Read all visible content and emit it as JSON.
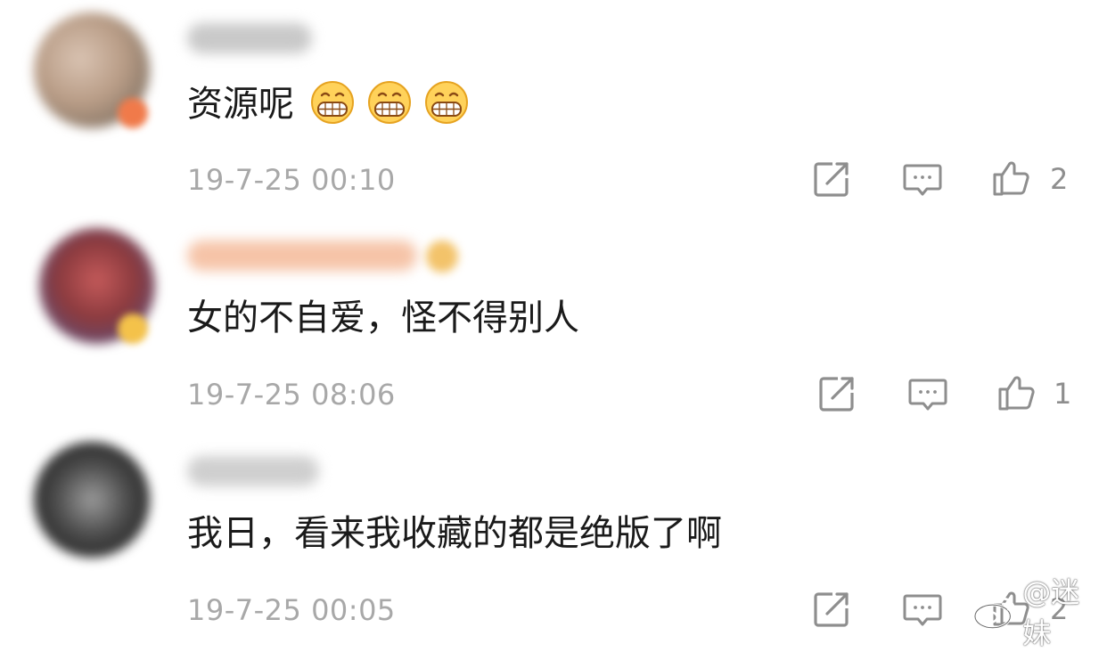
{
  "comments": [
    {
      "text": "资源呢",
      "emoji": [
        "grinning-face-icon",
        "grinning-face-icon",
        "grinning-face-icon"
      ],
      "time": "19-7-25 00:10",
      "likes": "2"
    },
    {
      "text": "女的不自爱，怪不得别人",
      "time": "19-7-25 08:06",
      "likes": "1"
    },
    {
      "text": "我日，看来我收藏的都是绝版了啊",
      "time": "19-7-25 00:05",
      "likes": "2"
    }
  ],
  "watermark": {
    "text": "@迷妹"
  },
  "colors": {
    "text": "#1a1a1a",
    "timestamp": "#a8a8a8",
    "icon": "#8e8e8e"
  }
}
